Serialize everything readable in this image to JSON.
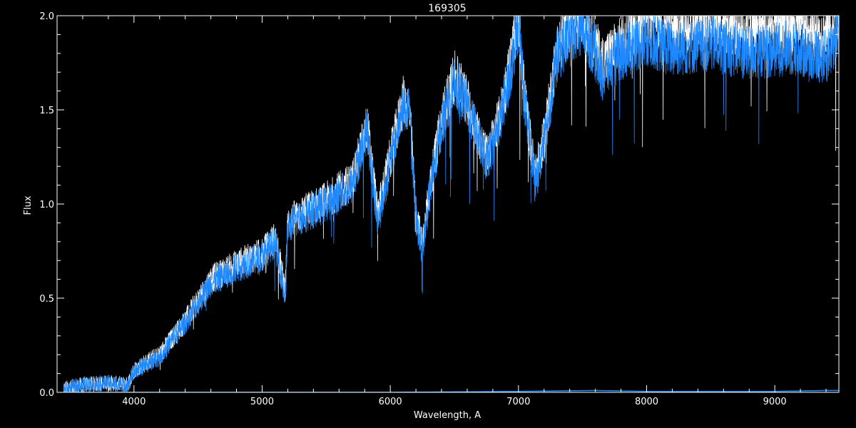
{
  "chart_data": {
    "type": "line",
    "title": "169305",
    "xlabel": "Wavelength, A",
    "ylabel": "Flux",
    "xlim": [
      3400,
      9500
    ],
    "ylim": [
      0.0,
      2.0
    ],
    "xticks": [
      "4000",
      "5000",
      "6000",
      "7000",
      "8000",
      "9000"
    ],
    "yticks": [
      "0.0",
      "0.5",
      "1.0",
      "1.5",
      "2.0"
    ],
    "grid": false,
    "colors": {
      "background": "#000000",
      "axes": "#ffffff",
      "observed": "#ffffff",
      "model": "#1e88ff",
      "residual": "#1e88ff"
    },
    "series": [
      {
        "x": [
          3450,
          3600,
          3800,
          3950,
          4000,
          4200,
          4400,
          4600,
          4800,
          5000,
          5100,
          5180,
          5200,
          5300,
          5500,
          5700,
          5820,
          5900,
          6000,
          6100,
          6150,
          6200,
          6250,
          6300,
          6400,
          6500,
          6600,
          6700,
          6750,
          6850,
          6950,
          7000,
          7050,
          7100,
          7130,
          7200,
          7300,
          7400,
          7500,
          7600,
          7650,
          7800,
          8000,
          8200,
          8500,
          8800,
          9100,
          9400,
          9500
        ],
        "values": [
          0.02,
          0.04,
          0.05,
          0.04,
          0.12,
          0.2,
          0.38,
          0.6,
          0.68,
          0.74,
          0.82,
          0.55,
          0.9,
          0.95,
          1.02,
          1.12,
          1.42,
          0.95,
          1.25,
          1.55,
          1.5,
          0.95,
          0.78,
          1.05,
          1.45,
          1.68,
          1.55,
          1.35,
          1.25,
          1.45,
          1.8,
          2.0,
          1.55,
          1.3,
          1.15,
          1.35,
          1.82,
          1.95,
          2.0,
          1.85,
          1.75,
          1.85,
          2.0,
          1.95,
          1.97,
          1.92,
          1.95,
          1.9,
          2.0
        ]
      },
      {
        "x": [
          3450,
          3600,
          3800,
          3950,
          4000,
          4200,
          4400,
          4600,
          4800,
          5000,
          5100,
          5180,
          5200,
          5300,
          5500,
          5700,
          5820,
          5900,
          6000,
          6100,
          6150,
          6200,
          6250,
          6300,
          6400,
          6500,
          6600,
          6700,
          6750,
          6850,
          6950,
          7000,
          7050,
          7100,
          7130,
          7200,
          7300,
          7400,
          7500,
          7600,
          7650,
          7800,
          8000,
          8200,
          8500,
          8800,
          9100,
          9400,
          9500
        ],
        "values": [
          0.02,
          0.04,
          0.05,
          0.04,
          0.11,
          0.19,
          0.37,
          0.58,
          0.66,
          0.72,
          0.8,
          0.5,
          0.88,
          0.93,
          1.0,
          1.1,
          1.4,
          0.9,
          1.22,
          1.52,
          1.48,
          0.92,
          0.75,
          1.02,
          1.42,
          1.65,
          1.52,
          1.32,
          1.22,
          1.42,
          1.75,
          1.97,
          1.52,
          1.28,
          1.1,
          1.32,
          1.78,
          1.9,
          1.95,
          1.8,
          1.68,
          1.8,
          1.88,
          1.82,
          1.85,
          1.8,
          1.83,
          1.78,
          1.9
        ]
      },
      {
        "x": [
          3450,
          4000,
          5000,
          6000,
          7000,
          7600,
          8000,
          9000,
          9400,
          9500
        ],
        "values": [
          0.0,
          0.0,
          0.0,
          0.0,
          0.005,
          0.01,
          0.005,
          0.005,
          0.01,
          0.01
        ]
      }
    ]
  }
}
